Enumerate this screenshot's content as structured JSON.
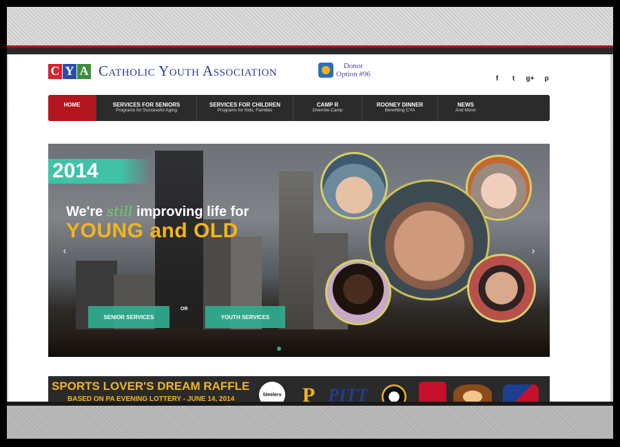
{
  "header": {
    "logo_letters": [
      "C",
      "Y",
      "A"
    ],
    "site_name": "Catholic Youth Association",
    "donor_line1": "Donor",
    "donor_line2": "Option #96",
    "social_icons": [
      "facebook-icon",
      "twitter-icon",
      "google-plus-icon",
      "pinterest-icon"
    ],
    "social_glyphs": [
      "f",
      "t",
      "g+",
      "p"
    ]
  },
  "nav": {
    "items": [
      {
        "title": "HOME",
        "subtitle": ""
      },
      {
        "title": "SERVICES FOR SENIORS",
        "subtitle": "Programs for Successful Aging"
      },
      {
        "title": "SERVICES FOR CHILDREN",
        "subtitle": "Programs for Kids, Families"
      },
      {
        "title": "CAMP R",
        "subtitle": "Overnite Camp"
      },
      {
        "title": "ROONEY DINNER",
        "subtitle": "Benefiting CYA"
      },
      {
        "title": "NEWS",
        "subtitle": "And More!"
      }
    ]
  },
  "hero": {
    "year": "2014",
    "headline_part1": "We're",
    "headline_emphasis": "still",
    "headline_part2": "improving life for",
    "headline_big": "YOUNG and OLD",
    "button_senior": "SENIOR SERVICES",
    "button_youth": "YOUTH SERVICES",
    "or_text": "OR",
    "prev_arrow": "‹",
    "next_arrow": "›"
  },
  "raffle": {
    "title": "SPORTS LOVER'S DREAM RAFFLE",
    "subtitle": "BASED ON PA EVENING LOTTERY - JUNE 14, 2014",
    "steelers_text": "Steelers",
    "pirates_letter": "P",
    "pitt_text": "PITT"
  },
  "colors": {
    "accent_red": "#b3151f",
    "brand_blue": "#2b3a8c",
    "teal": "#2fa88f",
    "gold": "#f3b51c"
  }
}
